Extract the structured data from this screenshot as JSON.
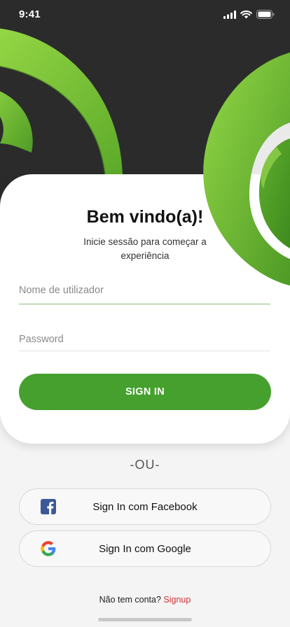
{
  "status_bar": {
    "time": "9:41"
  },
  "login": {
    "title": "Bem vindo(a)!",
    "subtitle": "Inicie sessão para começar a experiência",
    "username_placeholder": "Nome de utilizador",
    "username_value": "",
    "password_placeholder": "Password",
    "password_value": "",
    "sign_in_label": "SIGN IN"
  },
  "divider_text": "-OU-",
  "social": {
    "facebook_label": "Sign In com Facebook",
    "google_label": "Sign In com Google"
  },
  "footer": {
    "prompt": "Não tem conta?",
    "signup_label": "Signup"
  },
  "colors": {
    "accent_green": "#45a02d",
    "dark_background": "#2b2b2b",
    "signup_red": "#d32f2f",
    "facebook_blue": "#3b5998"
  },
  "icons": [
    "cellular-signal-icon",
    "wifi-icon",
    "battery-icon",
    "facebook-icon",
    "google-icon"
  ]
}
